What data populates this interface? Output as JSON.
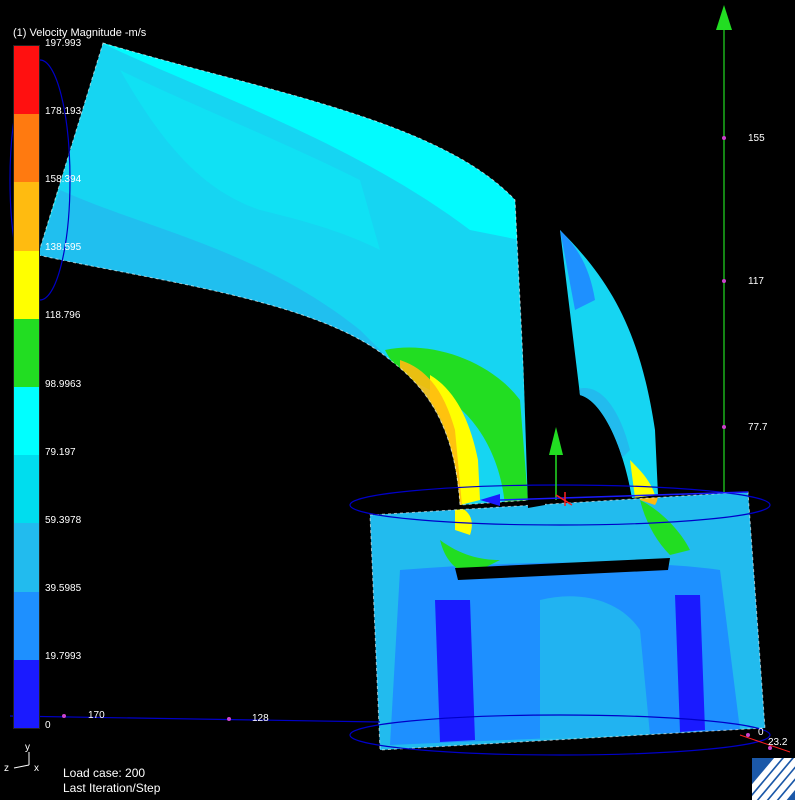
{
  "legend": {
    "title": "(1) Velocity Magnitude -m/s",
    "labels": [
      "197.993",
      "178.193",
      "158.394",
      "138.595",
      "118.796",
      "98.9963",
      "79.197",
      "59.3978",
      "39.5985",
      "19.7993",
      "0"
    ],
    "colors": [
      "#ff1010",
      "#ff7a10",
      "#ffbb10",
      "#ffff00",
      "#22dd22",
      "#00ffff",
      "#00ddee",
      "#22bbee",
      "#1e90ff",
      "#2f5bff",
      "#1a1aff"
    ]
  },
  "axis_ticks": {
    "vertical": [
      "155",
      "117",
      "77.7"
    ],
    "horizontal": [
      "170",
      "128"
    ],
    "corner": [
      "0",
      "23.2"
    ]
  },
  "triad": {
    "y": "y",
    "z": "z",
    "x": "x"
  },
  "status": {
    "load_case": "Load case: 200",
    "iteration": "Last Iteration/Step"
  },
  "colors": {
    "background": "#000000",
    "green_axis": "#22dd22",
    "outline": "#0000c8"
  }
}
